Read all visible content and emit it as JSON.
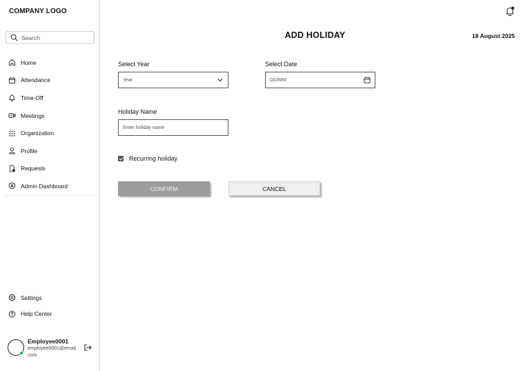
{
  "sidebar": {
    "logo": "COMPANY LOGO",
    "search_placeholder": "Search",
    "items": [
      {
        "label": "Home",
        "icon": "home-icon"
      },
      {
        "label": "Attendance",
        "icon": "calendar-icon"
      },
      {
        "label": "Time-Off",
        "icon": "bell-icon"
      },
      {
        "label": "Meetings",
        "icon": "video-icon"
      },
      {
        "label": "Organization",
        "icon": "grid-icon"
      },
      {
        "label": "Profile",
        "icon": "user-icon"
      },
      {
        "label": "Requests",
        "icon": "document-icon"
      },
      {
        "label": "Admin Dashboard",
        "icon": "shield-icon"
      }
    ],
    "bottom_items": [
      {
        "label": "Settings",
        "icon": "gear-icon"
      },
      {
        "label": "Help Center",
        "icon": "help-icon"
      }
    ],
    "user": {
      "name": "Employee0001",
      "email": "employee0001@email.com",
      "status_color": "#22a84a"
    }
  },
  "header": {
    "title": "ADD HOLIDAY",
    "date": "18 August 2025"
  },
  "form": {
    "year_label": "Select Year",
    "year_value": "Year",
    "date_label": "Select Date",
    "date_placeholder": "DD/MM",
    "name_label": "Holiday Name",
    "name_placeholder": "Enter holiday name",
    "recurring_label": "Recurring holiday",
    "recurring_checked": true
  },
  "actions": {
    "confirm_label": "CONFIRM",
    "cancel_label": "CANCEL",
    "confirm_color": "#9c9c9c"
  }
}
